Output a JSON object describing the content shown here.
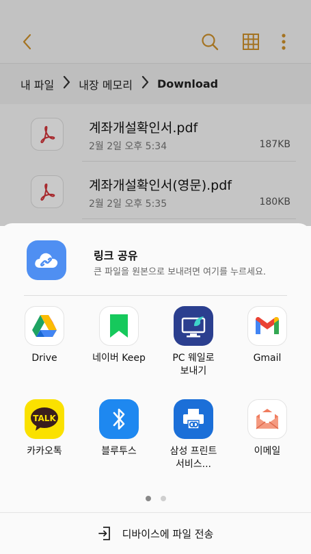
{
  "colors": {
    "accent": "#d1922b",
    "pdf_red": "#d4343a",
    "link_blue": "#4f8ff2"
  },
  "toolbar": {
    "back_icon": "chevron-left-icon",
    "search_icon": "search-icon",
    "grid_icon": "grid-view-icon",
    "more_icon": "more-vertical-icon"
  },
  "breadcrumb": {
    "items": [
      "내 파일",
      "내장 메모리",
      "Download"
    ]
  },
  "files": [
    {
      "name": "계좌개설확인서.pdf",
      "date": "2월 2일 오후 5:34",
      "size": "187KB",
      "icon": "pdf-icon"
    },
    {
      "name": "계좌개설확인서(영문).pdf",
      "date": "2월 2일 오후 5:35",
      "size": "180KB",
      "icon": "pdf-icon"
    }
  ],
  "share": {
    "link": {
      "title": "링크 공유",
      "description": "큰 파일을 원본으로 보내려면 여기를 누르세요.",
      "icon": "cloud-link-icon"
    },
    "apps": [
      {
        "label": "Drive",
        "icon": "google-drive-icon"
      },
      {
        "label": "네이버 Keep",
        "icon": "naver-keep-icon"
      },
      {
        "label": "PC 웨일로\n보내기",
        "icon": "whale-pc-icon"
      },
      {
        "label": "Gmail",
        "icon": "gmail-icon"
      },
      {
        "label": "카카오톡",
        "icon": "kakaotalk-icon"
      },
      {
        "label": "블루투스",
        "icon": "bluetooth-icon"
      },
      {
        "label": "삼성 프린트\n서비스...",
        "icon": "samsung-print-icon"
      },
      {
        "label": "이메일",
        "icon": "email-icon"
      }
    ],
    "page_indicator": {
      "pages": 2,
      "current": 1
    },
    "transfer_label": "디바이스에 파일 전송",
    "transfer_icon": "device-transfer-icon"
  }
}
